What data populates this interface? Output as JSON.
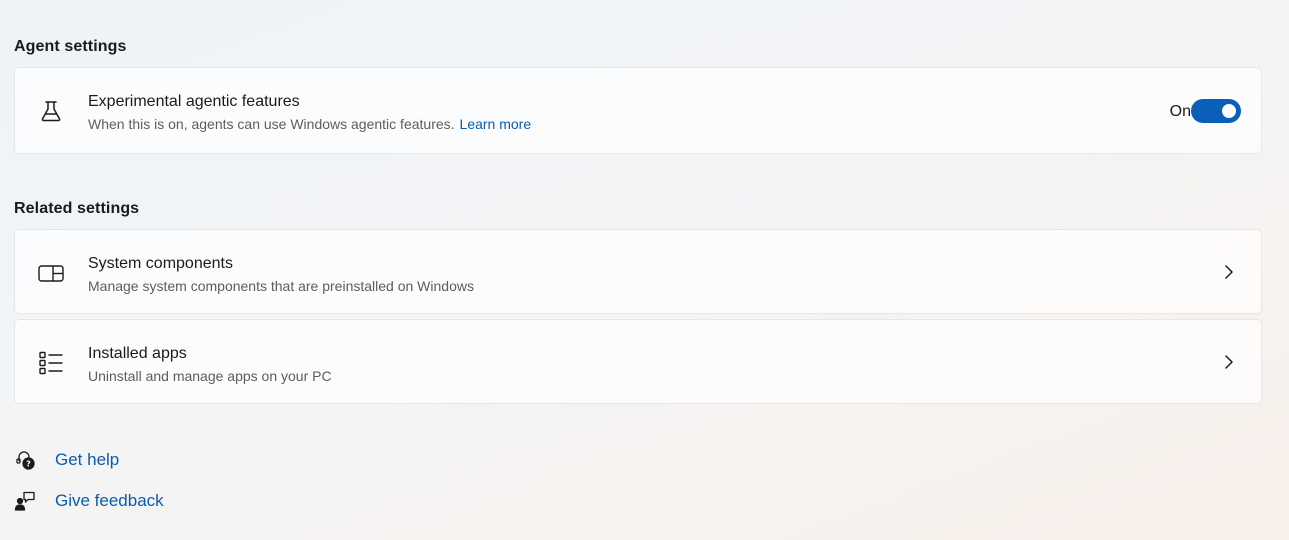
{
  "agent_settings": {
    "heading": "Agent settings",
    "experimental": {
      "icon": "flask-icon",
      "title": "Experimental agentic features",
      "description": "When this is on, agents can use Windows agentic features.",
      "link": "Learn more",
      "toggle_label": "On",
      "toggle_on": true,
      "toggle_color": "#0a5fb8"
    }
  },
  "related_settings": {
    "heading": "Related settings",
    "items": [
      {
        "icon": "system-components-icon",
        "title": "System components",
        "description": "Manage system components that are preinstalled on Windows"
      },
      {
        "icon": "installed-apps-icon",
        "title": "Installed apps",
        "description": "Uninstall and manage apps on your PC"
      }
    ]
  },
  "footer_links": [
    {
      "icon": "get-help-icon",
      "label": "Get help"
    },
    {
      "icon": "give-feedback-icon",
      "label": "Give feedback"
    }
  ],
  "colors": {
    "accent": "#0a5fb8",
    "link": "#0a5cad",
    "text": "#1b1b1b",
    "secondary_text": "#5d5d5d"
  }
}
